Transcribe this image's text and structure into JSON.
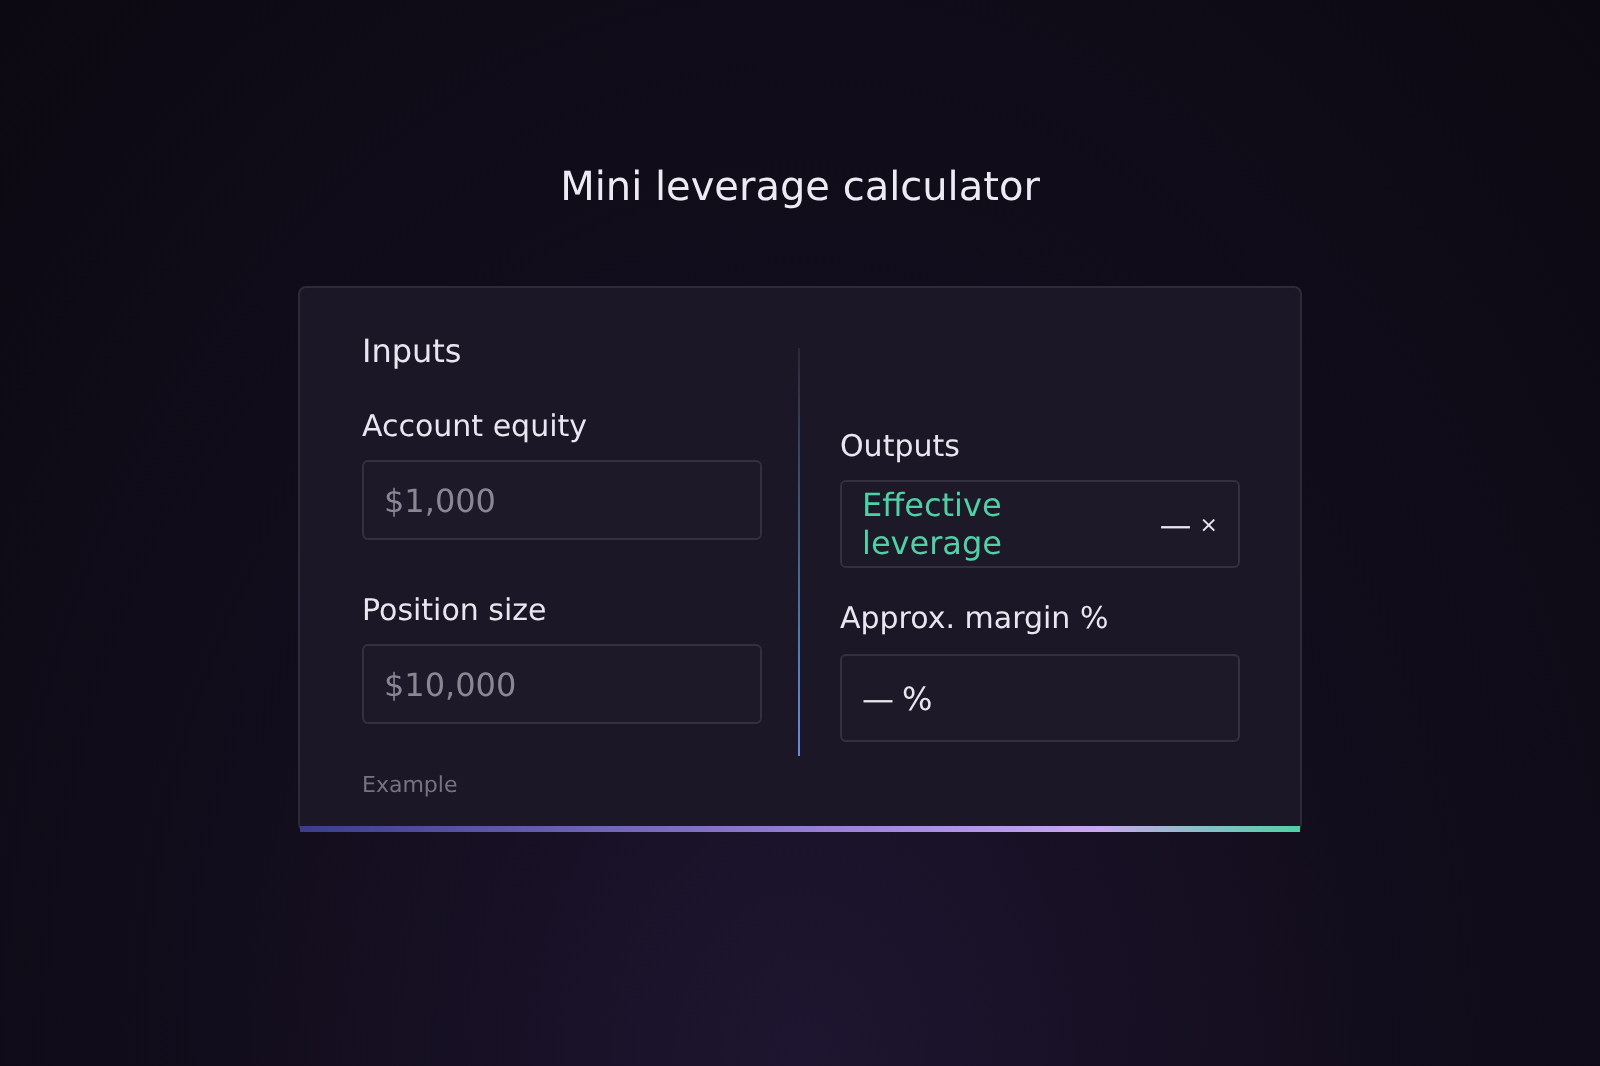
{
  "title": "Mini leverage calculator",
  "inputs": {
    "heading": "Inputs",
    "fields": [
      {
        "label": "Account equity",
        "placeholder": "$1,000"
      },
      {
        "label": "Position size",
        "placeholder": "$10,000"
      }
    ],
    "note": "Example"
  },
  "outputs": {
    "heading": "Outputs",
    "leverage": {
      "label": "Effective leverage",
      "value": "—",
      "unit": "×"
    },
    "margin": {
      "label": "Approx. margin %",
      "value": "—",
      "unit": "%"
    }
  }
}
